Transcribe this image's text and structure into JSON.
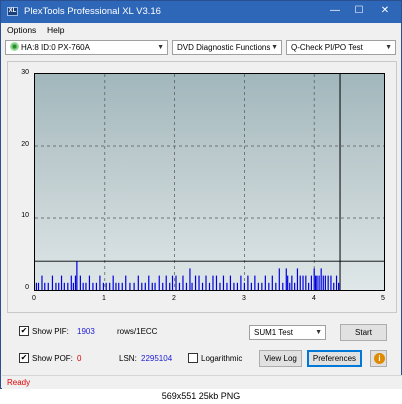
{
  "window": {
    "title": "PlexTools Professional XL V3.16",
    "app_icon_text": "XL",
    "minimize": "—",
    "maximize": "☐",
    "close": "✕"
  },
  "menu": {
    "items": [
      "Options",
      "Help"
    ]
  },
  "toolbar": {
    "drive": "HA:8 ID:0  PX-760A",
    "function": "DVD Diagnostic Functions",
    "test": "Q-Check PI/PO Test"
  },
  "chart_data": {
    "type": "bar",
    "xlim": [
      0,
      5
    ],
    "ylim": [
      0,
      30
    ],
    "x_ticks": [
      "0",
      "1",
      "2",
      "3",
      "4",
      "5"
    ],
    "y_ticks": [
      "30",
      "20",
      "10",
      "0"
    ],
    "grid": true,
    "colors": {
      "bars": "#0000e0",
      "cursor": "#000000",
      "threshold": "#000000"
    },
    "threshold_y": 4,
    "cursor_x": 4.37,
    "series": [
      {
        "x": [
          0.02,
          0.05,
          0.1,
          0.14,
          0.19,
          0.25,
          0.3,
          0.34,
          0.38,
          0.42,
          0.47,
          0.52,
          0.55,
          0.58,
          0.6,
          0.65,
          0.69,
          0.73,
          0.78,
          0.83,
          0.88,
          0.93,
          0.98,
          1.02,
          1.07,
          1.12,
          1.16,
          1.2,
          1.25,
          1.3,
          1.36,
          1.42,
          1.48,
          1.53,
          1.58,
          1.63,
          1.68,
          1.72,
          1.78,
          1.83,
          1.88,
          1.93,
          1.97,
          2.02,
          2.07,
          2.12,
          2.17,
          2.22,
          2.25,
          2.3,
          2.35,
          2.4,
          2.45,
          2.5,
          2.55,
          2.6,
          2.65,
          2.7,
          2.75,
          2.8,
          2.85,
          2.9,
          2.95,
          3.0,
          3.05,
          3.1,
          3.15,
          3.2,
          3.25,
          3.3,
          3.35,
          3.4,
          3.45,
          3.5,
          3.55,
          3.6,
          3.62,
          3.65,
          3.68,
          3.72,
          3.76,
          3.8,
          3.84,
          3.88,
          3.92,
          3.96,
          4.0,
          4.02,
          4.04,
          4.07,
          4.1,
          4.13,
          4.16,
          4.2,
          4.24,
          4.28,
          4.32,
          4.35
        ],
        "values": [
          1,
          1,
          2,
          1,
          1,
          2,
          1,
          1,
          2,
          1,
          1,
          2,
          1,
          2,
          4,
          2,
          1,
          1,
          2,
          1,
          1,
          2,
          1,
          1,
          1,
          2,
          1,
          1,
          1,
          2,
          1,
          1,
          2,
          1,
          1,
          2,
          1,
          1,
          2,
          1,
          2,
          1,
          2,
          2,
          1,
          2,
          1,
          3,
          1,
          2,
          2,
          1,
          2,
          1,
          2,
          2,
          1,
          2,
          1,
          2,
          1,
          1,
          2,
          1,
          2,
          1,
          2,
          1,
          1,
          2,
          1,
          2,
          1,
          3,
          1,
          3,
          2,
          1,
          2,
          1,
          3,
          2,
          2,
          2,
          1,
          2,
          3,
          2,
          2,
          2,
          3,
          2,
          2,
          2,
          2,
          1,
          2,
          1
        ]
      }
    ]
  },
  "controls": {
    "show_pif_label": "Show PIF:",
    "pif_value": "1903",
    "pif_unit": "rows/1ECC",
    "show_pof_label": "Show POF:",
    "pof_value": "0",
    "lsn_label": "LSN:",
    "lsn_value": "2295104",
    "logarithmic_label": "Logarithmic",
    "sum_select": "SUM1 Test",
    "start_button": "Start",
    "view_log_button": "View Log",
    "preferences_button": "Preferences",
    "info_button": "i",
    "check": "✔"
  },
  "status": {
    "text": "Ready"
  },
  "caption": {
    "text": "569x551  25kb  PNG"
  }
}
